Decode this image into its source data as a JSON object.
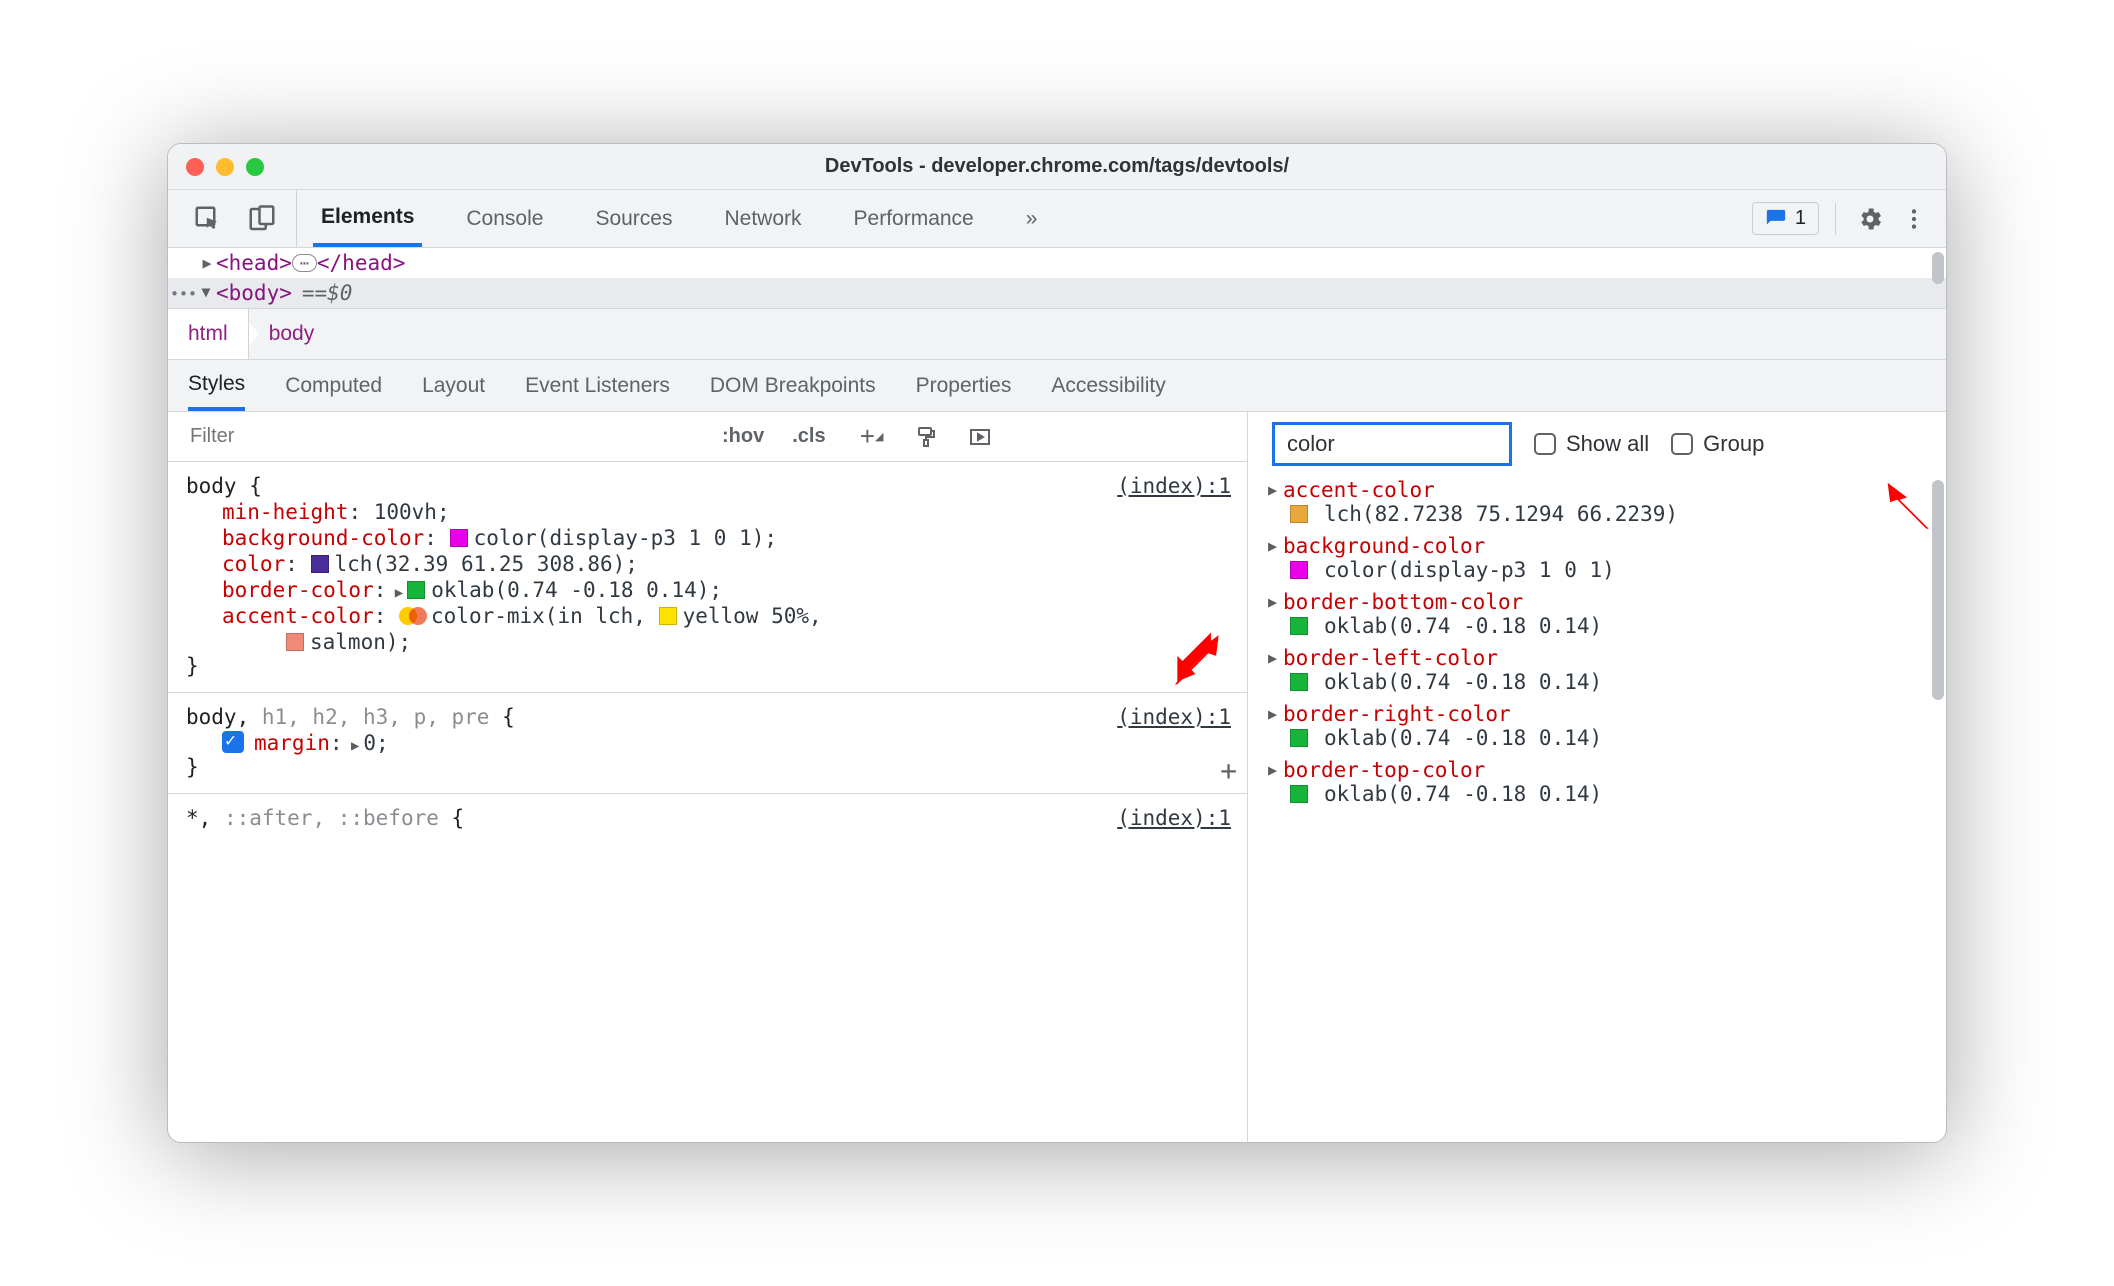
{
  "window": {
    "title": "DevTools - developer.chrome.com/tags/devtools/"
  },
  "toolbar": {
    "tabs": [
      "Elements",
      "Console",
      "Sources",
      "Network",
      "Performance"
    ],
    "active_tab": "Elements",
    "overflow_label": "»",
    "issues_count": "1"
  },
  "dom": {
    "head_open": "<head>",
    "head_close": "</head>",
    "body_open": "<body>",
    "eq": "== ",
    "dollar": "$0"
  },
  "breadcrumb": {
    "items": [
      "html",
      "body"
    ]
  },
  "subtabs": {
    "items": [
      "Styles",
      "Computed",
      "Layout",
      "Event Listeners",
      "DOM Breakpoints",
      "Properties",
      "Accessibility"
    ],
    "active": "Styles"
  },
  "styles_bar": {
    "filter_placeholder": "Filter",
    "hov": ":hov",
    "cls": ".cls"
  },
  "rule1": {
    "link": "(index):1",
    "selector": "body {",
    "d1_prop": "min-height",
    "d1_val": "100vh;",
    "d2_prop": "background-color",
    "d2_val": "color(display-p3 1 0 1);",
    "d2_swatch": "#e800e8",
    "d3_prop": "color",
    "d3_val": "lch(32.39 61.25 308.86);",
    "d3_swatch": "#4a2e9c",
    "d4_prop": "border-color",
    "d4_val": "oklab(0.74 -0.18 0.14);",
    "d4_swatch": "#18b53c",
    "d5_prop": "accent-color",
    "d5_val_a": "color-mix(in lch, ",
    "d5_val_b": "yellow 50%,",
    "d5_swatch_b": "#ffe100",
    "d5_line2_pre": "salmon);",
    "d5_swatch_c": "#f08b78",
    "close": "}"
  },
  "rule2": {
    "link": "(index):1",
    "selector_main": "body,",
    "selector_dim": " h1, h2, h3, p, pre ",
    "selector_open": "{",
    "d1_prop": "margin",
    "d1_val": "0;",
    "close": "}"
  },
  "rule3": {
    "link": "(index):1",
    "selector_main": "*,",
    "selector_dim": " ::after, ::before ",
    "selector_open": "{"
  },
  "right": {
    "search_value": "color",
    "show_all": "Show all",
    "group": "Group"
  },
  "computed": [
    {
      "prop": "accent-color",
      "val": "lch(82.7238 75.1294 66.2239)",
      "swatch": "#e8a83c"
    },
    {
      "prop": "background-color",
      "val": "color(display-p3 1 0 1)",
      "swatch": "#e800e8"
    },
    {
      "prop": "border-bottom-color",
      "val": "oklab(0.74 -0.18 0.14)",
      "swatch": "#18b53c"
    },
    {
      "prop": "border-left-color",
      "val": "oklab(0.74 -0.18 0.14)",
      "swatch": "#18b53c"
    },
    {
      "prop": "border-right-color",
      "val": "oklab(0.74 -0.18 0.14)",
      "swatch": "#18b53c"
    },
    {
      "prop": "border-top-color",
      "val": "oklab(0.74 -0.18 0.14)",
      "swatch": "#18b53c"
    }
  ]
}
